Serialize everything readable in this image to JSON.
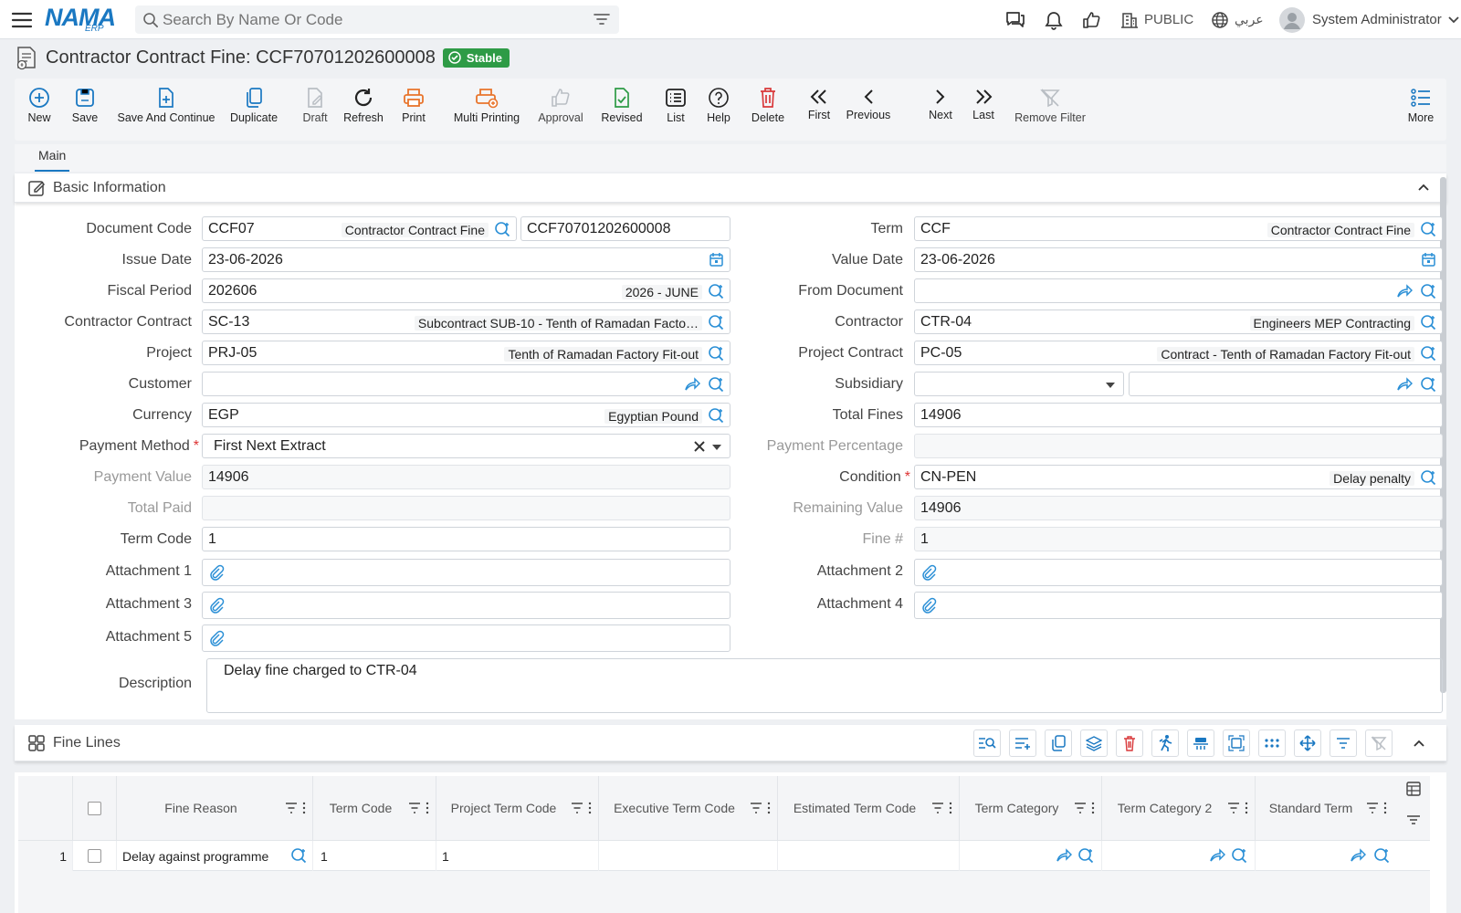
{
  "app": {
    "logo": "NAMA",
    "logo_sub": "ERP"
  },
  "search": {
    "placeholder": "Search By Name Or Code"
  },
  "header": {
    "branch": "PUBLIC",
    "language": "عربي",
    "user": "System Administrator"
  },
  "page": {
    "title": "Contractor Contract Fine: CCF70701202600008",
    "status": "Stable"
  },
  "toolbar": {
    "new": "New",
    "save": "Save",
    "save_continue": "Save And Continue",
    "duplicate": "Duplicate",
    "draft": "Draft",
    "refresh": "Refresh",
    "print": "Print",
    "multi_printing": "Multi Printing",
    "approval": "Approval",
    "revised": "Revised",
    "list": "List",
    "help": "Help",
    "delete": "Delete",
    "first": "First",
    "previous": "Previous",
    "next": "Next",
    "last": "Last",
    "remove_filter": "Remove Filter",
    "more": "More"
  },
  "tabs": {
    "main": "Main"
  },
  "basic": {
    "title": "Basic Information",
    "document_code": {
      "label": "Document Code",
      "code": "CCF07",
      "desc": "Contractor Contract Fine",
      "number": "CCF70701202600008"
    },
    "term": {
      "label": "Term",
      "code": "CCF",
      "desc": "Contractor Contract Fine"
    },
    "issue_date": {
      "label": "Issue Date",
      "value": "23-06-2026"
    },
    "value_date": {
      "label": "Value Date",
      "value": "23-06-2026"
    },
    "fiscal_period": {
      "label": "Fiscal Period",
      "code": "202606",
      "desc": "2026 - JUNE"
    },
    "from_document": {
      "label": "From Document",
      "value": ""
    },
    "contractor_contract": {
      "label": "Contractor Contract",
      "code": "SC-13",
      "desc": "Subcontract SUB-10 - Tenth of Ramadan Facto…"
    },
    "contractor": {
      "label": "Contractor",
      "code": "CTR-04",
      "desc": "Engineers MEP Contracting"
    },
    "project": {
      "label": "Project",
      "code": "PRJ-05",
      "desc": "Tenth of Ramadan Factory Fit-out"
    },
    "project_contract": {
      "label": "Project Contract",
      "code": "PC-05",
      "desc": "Contract - Tenth of Ramadan Factory Fit-out"
    },
    "customer": {
      "label": "Customer",
      "value": ""
    },
    "subsidiary": {
      "label": "Subsidiary",
      "value": ""
    },
    "currency": {
      "label": "Currency",
      "code": "EGP",
      "desc": "Egyptian Pound"
    },
    "total_fines": {
      "label": "Total Fines",
      "value": "14906"
    },
    "payment_method": {
      "label": "Payment Method",
      "value": "First Next Extract"
    },
    "payment_percentage": {
      "label": "Payment Percentage",
      "value": ""
    },
    "payment_value": {
      "label": "Payment Value",
      "value": "14906"
    },
    "condition": {
      "label": "Condition",
      "code": "CN-PEN",
      "desc": "Delay penalty"
    },
    "total_paid": {
      "label": "Total Paid",
      "value": ""
    },
    "remaining_value": {
      "label": "Remaining Value",
      "value": "14906"
    },
    "term_code": {
      "label": "Term Code",
      "value": "1"
    },
    "fine_no": {
      "label": "Fine #",
      "value": "1"
    },
    "attachment1": {
      "label": "Attachment 1"
    },
    "attachment2": {
      "label": "Attachment 2"
    },
    "attachment3": {
      "label": "Attachment 3"
    },
    "attachment4": {
      "label": "Attachment 4"
    },
    "attachment5": {
      "label": "Attachment 5"
    },
    "description": {
      "label": "Description",
      "value": "Delay fine charged to CTR-04"
    }
  },
  "fine_lines": {
    "title": "Fine Lines",
    "columns": [
      "Fine Reason",
      "Term Code",
      "Project Term Code",
      "Executive Term Code",
      "Estimated Term Code",
      "Term Category",
      "Term Category 2",
      "Standard Term"
    ],
    "rows": [
      {
        "index": "1",
        "fine_reason": "Delay against programme",
        "term_code": "1",
        "project_term_code": "1",
        "executive_term_code": "",
        "estimated_term_code": "",
        "term_category": "",
        "term_category_2": "",
        "standard_term": ""
      }
    ]
  },
  "colors": {
    "accent": "#1a78c2",
    "success": "#2e9b46",
    "danger": "#d9383a",
    "print": "#e8742b"
  }
}
